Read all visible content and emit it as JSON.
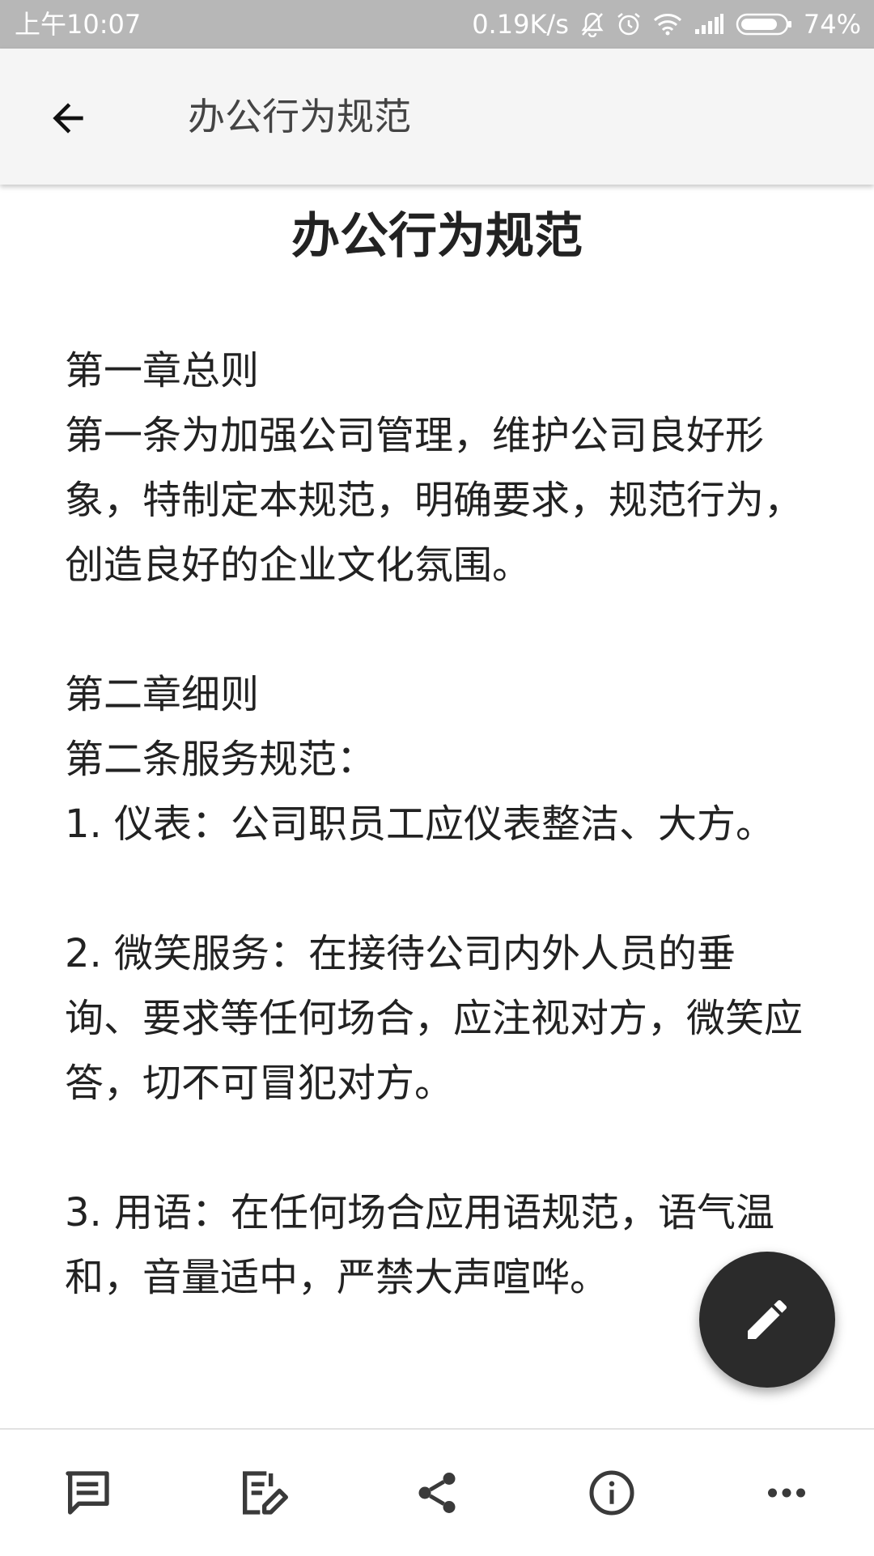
{
  "status_bar": {
    "time": "上午10:07",
    "network_speed": "0.19K/s",
    "battery": "74%",
    "icons": [
      "mute-icon",
      "alarm-icon",
      "wifi-icon",
      "signal-icon",
      "battery-icon"
    ]
  },
  "app_bar": {
    "title": "办公行为规范",
    "back_icon": "arrow-back-icon"
  },
  "document": {
    "title": "办公行为规范",
    "chapter1_heading": "第一章总则",
    "chapter1_article1": "第一条为加强公司管理，维护公司良好形象，特制定本规范，明确要求，规范行为，创造良好的企业文化氛围。",
    "chapter2_heading": "第二章细则",
    "chapter2_article2": "第二条服务规范：",
    "item1": "1. 仪表：公司职员工应仪表整洁、大方。",
    "item2": "2. 微笑服务：在接待公司内外人员的垂询、要求等任何场合，应注视对方，微笑应答，切不可冒犯对方。",
    "item3": "3. 用语：在任何场合应用语规范，语气温和，音量适中，严禁大声喧哗。"
  },
  "fab": {
    "icon": "edit-icon"
  },
  "bottom_bar": {
    "items": [
      "comment-icon",
      "edit-note-icon",
      "share-icon",
      "info-icon",
      "more-icon"
    ]
  },
  "colors": {
    "status_bar": "#b7b7b7",
    "app_bar": "#f5f5f5",
    "fab": "#2b2b2b",
    "text": "#222222"
  }
}
